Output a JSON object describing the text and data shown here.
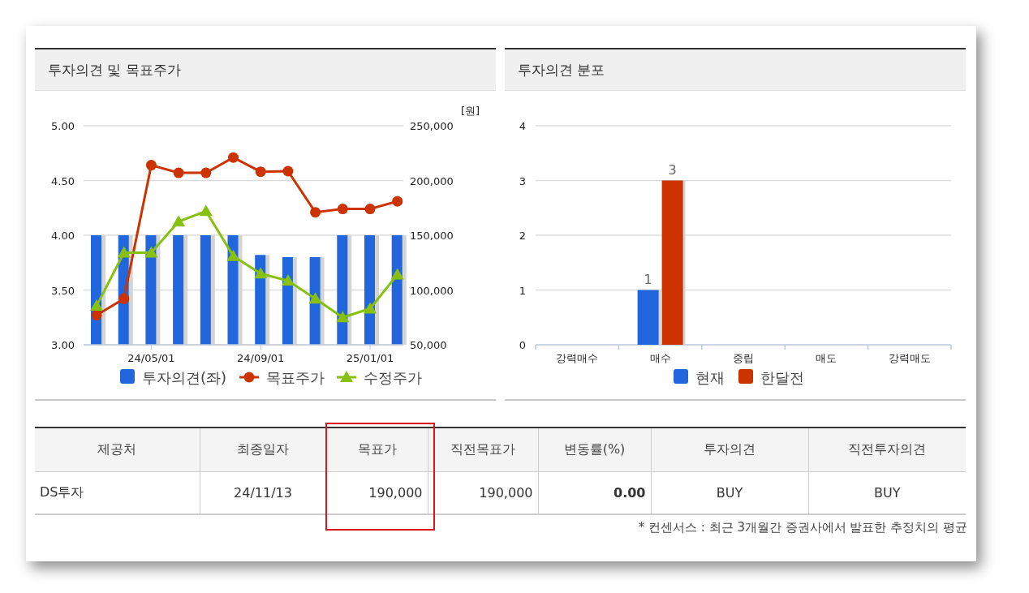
{
  "panels": [
    {
      "title": "투자의견 및 목표주가",
      "chart_data": {
        "type": "bar",
        "grid": true,
        "legend": "bottom",
        "categories": [
          null,
          null,
          "24/05/01",
          null,
          null,
          null,
          "24/09/01",
          null,
          null,
          null,
          "25/01/01",
          null
        ],
        "ylim": [
          3,
          5
        ],
        "yticks": [
          {
            "value": 3,
            "label": "3.00"
          },
          {
            "value": 3.5,
            "label": "3.50"
          },
          {
            "value": 4,
            "label": "4.00"
          },
          {
            "value": 4.5,
            "label": "4.50"
          },
          {
            "value": 5,
            "label": "5.00"
          }
        ],
        "y2label": "[원]",
        "y2lim": [
          50000,
          250000
        ],
        "y2ticks": [
          {
            "value": 50000,
            "label": "50,000"
          },
          {
            "value": 100000,
            "label": "100,000"
          },
          {
            "value": 150000,
            "label": "150,000"
          },
          {
            "value": 200000,
            "label": "200,000"
          },
          {
            "value": 250000,
            "label": "250,000"
          }
        ],
        "series": [
          {
            "name": "투자의견(좌)",
            "type": "bar",
            "color": "#2166dd",
            "values": [
              4,
              4,
              4,
              4,
              4,
              4,
              3.82,
              3.8,
              3.8,
              4,
              4,
              4
            ]
          },
          {
            "name": "목표주가",
            "type": "line",
            "marker": "circle",
            "axis": "y2",
            "color": "#cc3300",
            "values": [
              77000,
              92000,
              214000,
              207000,
              207000,
              221000,
              208000,
              208500,
              171000,
              174000,
              174000,
              181000
            ]
          },
          {
            "name": "수정주가",
            "type": "line",
            "marker": "triangle",
            "axis": "y2",
            "color": "#88c010",
            "values": [
              85500,
              134000,
              134000,
              162500,
              172000,
              131000,
              115000,
              108500,
              92000,
              75000,
              83000,
              114000
            ]
          }
        ]
      }
    },
    {
      "title": "투자의견 분포",
      "chart_data": {
        "type": "bar",
        "grid": true,
        "legend": "bottom",
        "categories": [
          "강력매수",
          "매수",
          "중립",
          "매도",
          "강력매도"
        ],
        "ylim": [
          0,
          4
        ],
        "yticks": [
          0,
          1,
          2,
          3,
          4
        ],
        "value_labels": [
          [
            null,
            "1",
            null,
            null,
            null
          ],
          [
            null,
            "3",
            null,
            null,
            null
          ]
        ],
        "series": [
          {
            "name": "현재",
            "color": "#2166dd",
            "values": [
              0,
              1,
              0,
              0,
              0
            ]
          },
          {
            "name": "한달전",
            "color": "#cc3300",
            "values": [
              0,
              3,
              0,
              0,
              0
            ]
          }
        ]
      }
    }
  ],
  "table": {
    "columns": [
      {
        "label": "제공처",
        "highlighted": false
      },
      {
        "label": "최종일자",
        "highlighted": false
      },
      {
        "label": "목표가",
        "highlighted": true
      },
      {
        "label": "직전목표가",
        "highlighted": false
      },
      {
        "label": "변동률(%)",
        "highlighted": false
      },
      {
        "label": "투자의견",
        "highlighted": false
      },
      {
        "label": "직전투자의견",
        "highlighted": false
      }
    ],
    "rows": [
      {
        "cells": [
          "DS투자",
          "24/11/13",
          "190,000",
          "190,000",
          "0.00",
          "BUY",
          "BUY"
        ],
        "bold": [
          false,
          false,
          false,
          false,
          true,
          false,
          false
        ]
      }
    ]
  },
  "footnote": "* 컨센서스 : 최근 3개월간 증권사에서 발표한 추정치의 평균"
}
